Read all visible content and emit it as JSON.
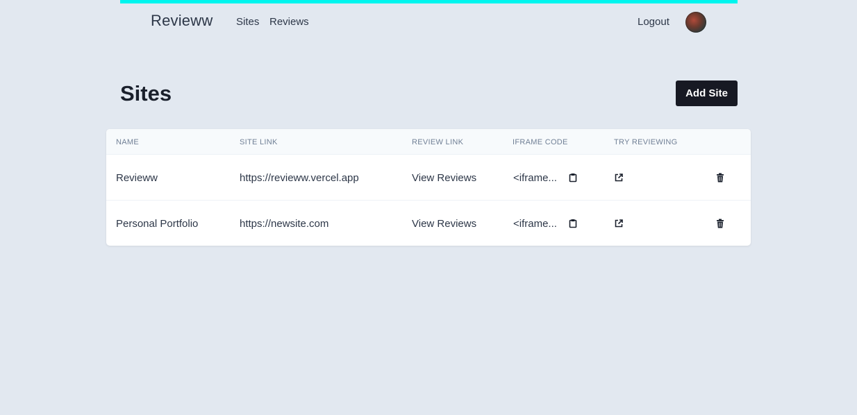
{
  "nav": {
    "brand": "Revieww",
    "links": [
      "Sites",
      "Reviews"
    ],
    "logout": "Logout"
  },
  "page": {
    "title": "Sites",
    "add_button": "Add Site"
  },
  "table": {
    "headers": [
      "NAME",
      "SITE LINK",
      "REVIEW LINK",
      "IFRAME CODE",
      "TRY REVIEWING"
    ],
    "rows": [
      {
        "name": "Revieww",
        "site_link": "https://revieww.vercel.app",
        "review_link": "View Reviews",
        "iframe_code": "<iframe..."
      },
      {
        "name": "Personal Portfolio",
        "site_link": "https://newsite.com",
        "review_link": "View Reviews",
        "iframe_code": "<iframe..."
      }
    ]
  },
  "colors": {
    "accent_bar": "#00f5ee",
    "background": "#e2e8f0",
    "button_bg": "#171923"
  },
  "icons": {
    "copy": "clipboard-icon",
    "try": "external-link-icon",
    "delete": "trash-icon"
  }
}
